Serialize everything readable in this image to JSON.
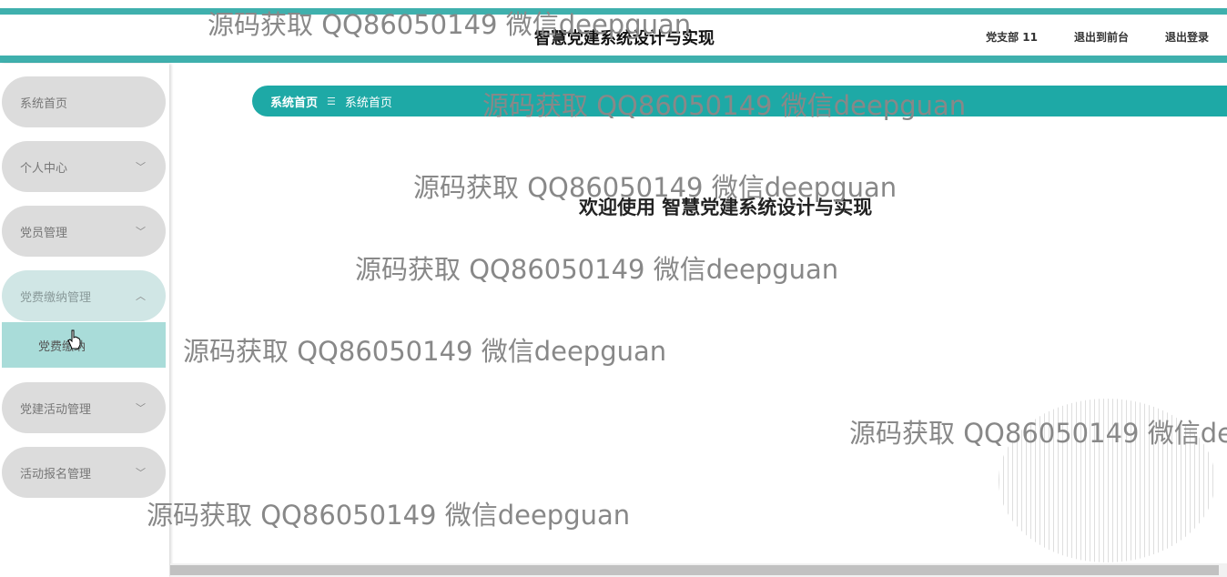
{
  "app": {
    "title": "智慧党建系统设计与实现"
  },
  "header": {
    "user_label": "党支部 11",
    "exit_to_front_label": "退出到前台",
    "logout_label": "退出登录"
  },
  "sidebar": {
    "items": [
      {
        "label": "系统首页",
        "has_chevron": false,
        "expanded": false
      },
      {
        "label": "个人中心",
        "has_chevron": true,
        "expanded": false
      },
      {
        "label": "党员管理",
        "has_chevron": true,
        "expanded": false
      },
      {
        "label": "党费缴纳管理",
        "has_chevron": true,
        "expanded": true
      },
      {
        "label": "党建活动管理",
        "has_chevron": true,
        "expanded": false
      },
      {
        "label": "活动报名管理",
        "has_chevron": true,
        "expanded": false
      }
    ],
    "submenu": {
      "label": "党费缴纳"
    }
  },
  "breadcrumb": {
    "home": "系统首页",
    "separator": "☰",
    "current": "系统首页"
  },
  "main": {
    "welcome": "欢迎使用 智慧党建系统设计与实现"
  },
  "watermark": {
    "text": "源码获取 QQ86050149 微信deepguan"
  },
  "colors": {
    "accent": "#1ea9a6",
    "stripe": "#3fb0ad",
    "menu_bg": "#dcdcdc",
    "submenu_bg": "#a9dcd9"
  }
}
